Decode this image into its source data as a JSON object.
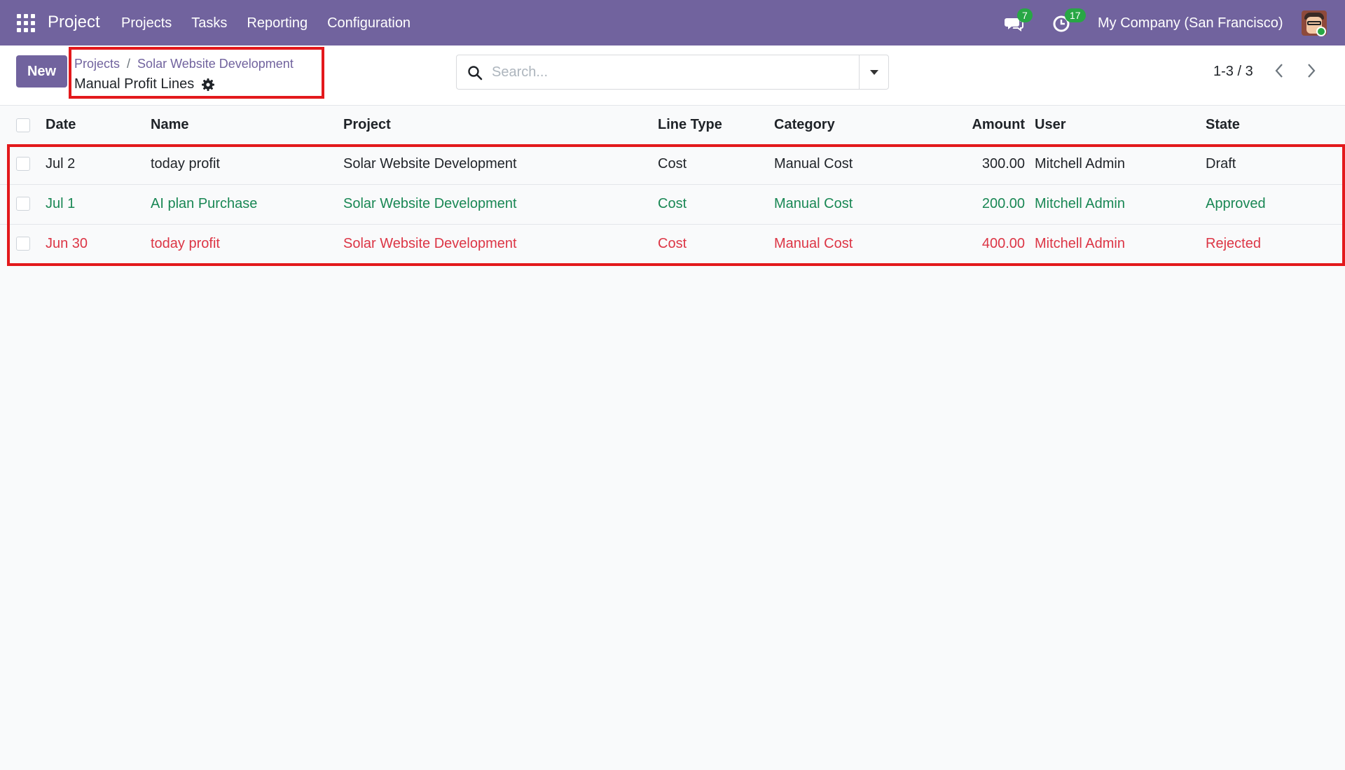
{
  "navbar": {
    "brand": "Project",
    "menu": [
      "Projects",
      "Tasks",
      "Reporting",
      "Configuration"
    ],
    "messages_count": "7",
    "activities_count": "17",
    "company": "My Company (San Francisco)",
    "accent_color": "#71639e"
  },
  "control_panel": {
    "new_label": "New",
    "breadcrumb": [
      "Projects",
      "Solar Website Development"
    ],
    "breadcrumb_separator": "/",
    "title": "Manual Profit Lines",
    "search_placeholder": "Search...",
    "pager": "1-3 / 3"
  },
  "list": {
    "columns": {
      "date": "Date",
      "name": "Name",
      "project": "Project",
      "line_type": "Line Type",
      "category": "Category",
      "amount": "Amount",
      "user": "User",
      "state": "State"
    },
    "rows": [
      {
        "date": "Jul 2",
        "name": "today profit",
        "project": "Solar Website Development",
        "line_type": "Cost",
        "category": "Manual Cost",
        "amount": "300.00",
        "user": "Mitchell Admin",
        "state": "Draft",
        "status_color": "#1f2328"
      },
      {
        "date": "Jul 1",
        "name": "AI plan Purchase",
        "project": "Solar Website Development",
        "line_type": "Cost",
        "category": "Manual Cost",
        "amount": "200.00",
        "user": "Mitchell Admin",
        "state": "Approved",
        "status_color": "#198754"
      },
      {
        "date": "Jun 30",
        "name": "today profit",
        "project": "Solar Website Development",
        "line_type": "Cost",
        "category": "Manual Cost",
        "amount": "400.00",
        "user": "Mitchell Admin",
        "state": "Rejected",
        "status_color": "#dc3545"
      }
    ]
  }
}
